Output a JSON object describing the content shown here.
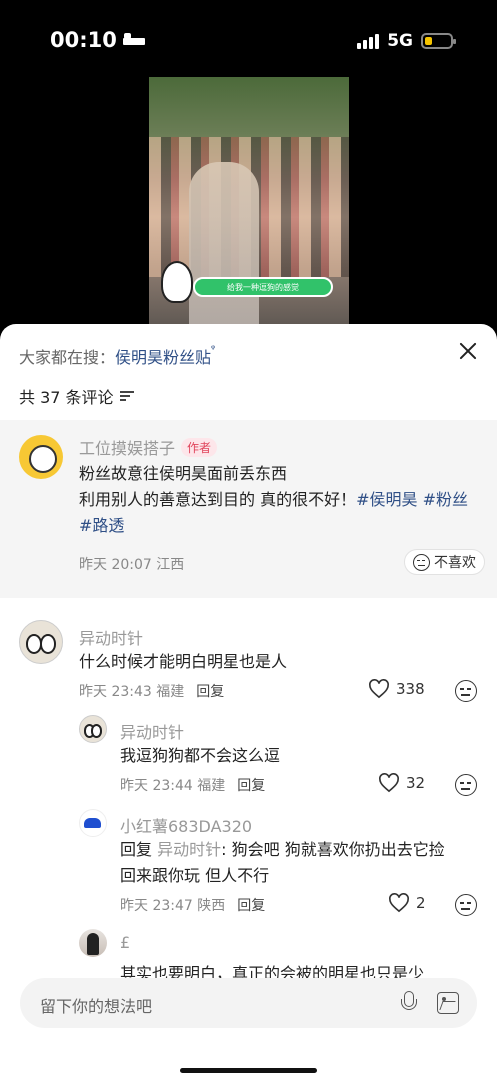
{
  "status_bar": {
    "time": "00:10",
    "network": "5G"
  },
  "video": {
    "sticker_text": "给我一种逗狗的感觉"
  },
  "sheet": {
    "search_prefix": "大家都在搜：",
    "search_term": "侯明昊粉丝贴",
    "comment_count": "共 37 条评论"
  },
  "pinned_comment": {
    "author": "工位摸娱搭子",
    "author_tag": "作者",
    "line1": "粉丝故意往侯明昊面前丢东西",
    "line2_text": "利用别人的善意达到目的 真的很不好！",
    "hashtag1": "#侯明昊",
    "hashtag2": "#粉丝",
    "hashtag3": "#路透",
    "time": "昨天 20:07",
    "location": "江西",
    "dislike_label": "不喜欢"
  },
  "comments": [
    {
      "author": "异动时针",
      "text": "什么时候才能明白明星也是人",
      "time": "昨天 23:43",
      "location": "福建",
      "reply_label": "回复",
      "likes": "338"
    },
    {
      "author": "异动时针",
      "text": "我逗狗狗都不会这么逗",
      "time": "昨天 23:44",
      "location": "福建",
      "reply_label": "回复",
      "likes": "32"
    },
    {
      "author": "小红薯683DA320",
      "reply_prefix": "回复",
      "reply_to": "异动时针",
      "text_line1": ": 狗会吧 狗就喜欢你扔出去它捡",
      "text_line2": "回来跟你玩 但人不行",
      "time": "昨天 23:47",
      "location": "陕西",
      "reply_label": "回复",
      "likes": "2"
    },
    {
      "author": "£",
      "text_partial": "其实也要明白，真正的会被的明星也只是少"
    }
  ],
  "input": {
    "placeholder": "留下你的想法吧"
  },
  "icons": [
    "sleep-mode-icon",
    "signal-icon",
    "battery-icon",
    "search-suggest-icon",
    "close-icon",
    "filter-icon",
    "dislike-face-icon",
    "heart-icon",
    "emoji-icon",
    "mic-icon",
    "image-icon"
  ]
}
